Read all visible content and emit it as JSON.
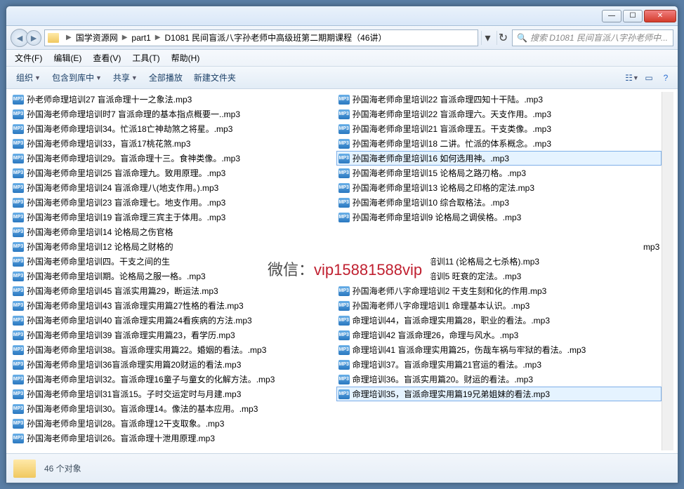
{
  "window": {
    "min": "—",
    "max": "☐",
    "close": "✕"
  },
  "breadcrumb": {
    "items": [
      "国学资源网",
      "part1",
      "D1081 民间盲派八字孙老师中高级班第二期期课程（46讲）"
    ]
  },
  "search": {
    "placeholder": "搜索 D1081 民间盲派八字孙老师中..."
  },
  "menu": {
    "file": "文件(F)",
    "edit": "编辑(E)",
    "view": "查看(V)",
    "tools": "工具(T)",
    "help": "帮助(H)"
  },
  "toolbar": {
    "organize": "组织",
    "include": "包含到库中",
    "share": "共享",
    "playall": "全部播放",
    "newfolder": "新建文件夹"
  },
  "overlay": {
    "label": "微信：",
    "value": "vip15881588vip"
  },
  "status": {
    "text": "46 个对象"
  },
  "files_left": [
    "孙老师命理培训27 盲派命理十一之象法.mp3",
    "孙国海老师命理培训时7 盲派命理的基本指点概要一..mp3",
    "孙国海老师命理培训34。忙派18亡神劫煞之将星。.mp3",
    "孙国海老师命理培训33，盲派17桃花煞.mp3",
    "孙国海老师命理培训29。盲派命理十三。食神类像。.mp3",
    "孙国海老师命里培训25 盲派命理九。致用原理。.mp3",
    "孙国海老师命里培训24 盲派命理八(地支作用。).mp3",
    "孙国海老师命里培训23 盲派命理七。地支作用。.mp3",
    "孙国海老师命里培训19 盲派命理三宾主于体用。.mp3",
    "孙国海老师命里培训14 论格局之伤官格",
    "孙国海老师命里培训12 论格局之财格的",
    "孙国海老师命里培训四。干支之间的生",
    "孙国海老师命里培训期。论格局之服一格。.mp3",
    "孙国海老师命里培训45 盲派实用篇29，断运法.mp3",
    "孙国海老师命里培训43 盲派命理实用篇27性格的看法.mp3",
    "孙国海老师命里培训40 盲派命理实用篇24看疾病的方法.mp3",
    "孙国海老师命里培训39 盲派命理实用篇23，看学历.mp3",
    "孙国海老师命里培训38。盲派命理实用篇22。婚姻的看法。.mp3",
    "孙国海老师命里培训36盲派命理实用篇20财运的看法.mp3",
    "孙国海老师命里培训32。盲派命理16童子与童女的化解方法。.mp3",
    "孙国海老师命里培训31盲派15。子时交运定时与月建.mp3",
    "孙国海老师命里培训30。盲派命理14。像法的基本应用。.mp3",
    "孙国海老师命里培训28。盲派命理12干支取象。.mp3",
    "孙国海老师命里培训26。盲派命理十泄用原理.mp3"
  ],
  "files_right": [
    {
      "t": "孙国海老师命里培训22 盲派命理四知十干陆。.mp3"
    },
    {
      "t": "孙国海老师命里培训22 盲派命理六。天支作用。.mp3"
    },
    {
      "t": "孙国海老师命里培训21 盲派命理五。干支类像。.mp3"
    },
    {
      "t": "孙国海老师命里培训18 二讲。忙派的体系概念。.mp3"
    },
    {
      "t": "孙国海老师命里培训16 如何选用神。.mp3",
      "sel": true
    },
    {
      "t": "孙国海老师命里培训15 论格局之路刃格。.mp3"
    },
    {
      "t": "孙国海老师命里培训13 论格局之印格的定法.mp3"
    },
    {
      "t": "孙国海老师命里培训10 综合取格法。.mp3"
    },
    {
      "t": "孙国海老师命里培训9 论格局之调侯格。.mp3"
    },
    {
      "t": ""
    },
    {
      "t": "mp3",
      "pad": true
    },
    {
      "t": "孙国海老师八字命理培训11 (论格局之七杀格).mp3"
    },
    {
      "t": "孙国海老师八字命理培训5 旺衰的定法。.mp3"
    },
    {
      "t": "孙国海老师八字命理培训2 干支生刻和化的作用.mp3"
    },
    {
      "t": "孙国海老师八字命理培训1 命理基本认识。.mp3"
    },
    {
      "t": "命理培训44，盲派命理实用篇28，职业的看法。.mp3"
    },
    {
      "t": "命理培训42  盲派命理26，命理与风水。.mp3"
    },
    {
      "t": "命理培训41  盲派命理实用篇25，伤哉车祸与牢狱的看法。.mp3"
    },
    {
      "t": "命理培训37。盲派命理实用篇21官运的看法。.mp3"
    },
    {
      "t": "命理培训36。盲派实用篇20。财运的看法。.mp3"
    },
    {
      "t": "命理培训35，盲派命理实用篇19兄弟姐妹的看法.mp3",
      "sel": true
    }
  ]
}
